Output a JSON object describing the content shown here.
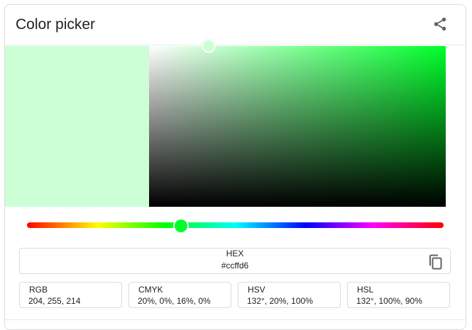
{
  "header": {
    "title": "Color picker",
    "share_icon": "share-icon"
  },
  "color": {
    "hex": "#ccffd6",
    "hue_hex": "#00ff2b",
    "hue_fraction": 0.37,
    "saturation_fraction": 0.2,
    "value_fraction": 1.0
  },
  "fields": {
    "hex": {
      "label": "HEX",
      "value": "#ccffd6",
      "icon": "copy-icon"
    },
    "rgb": {
      "label": "RGB",
      "value": "204, 255, 214"
    },
    "cmyk": {
      "label": "CMYK",
      "value": "20%, 0%, 16%, 0%"
    },
    "hsv": {
      "label": "HSV",
      "value": "132°, 20%, 100%"
    },
    "hsl": {
      "label": "HSL",
      "value": "132°, 100%, 90%"
    }
  },
  "colors": {
    "border": "#dadce0",
    "text": "#202124",
    "icon": "#5f6368"
  }
}
